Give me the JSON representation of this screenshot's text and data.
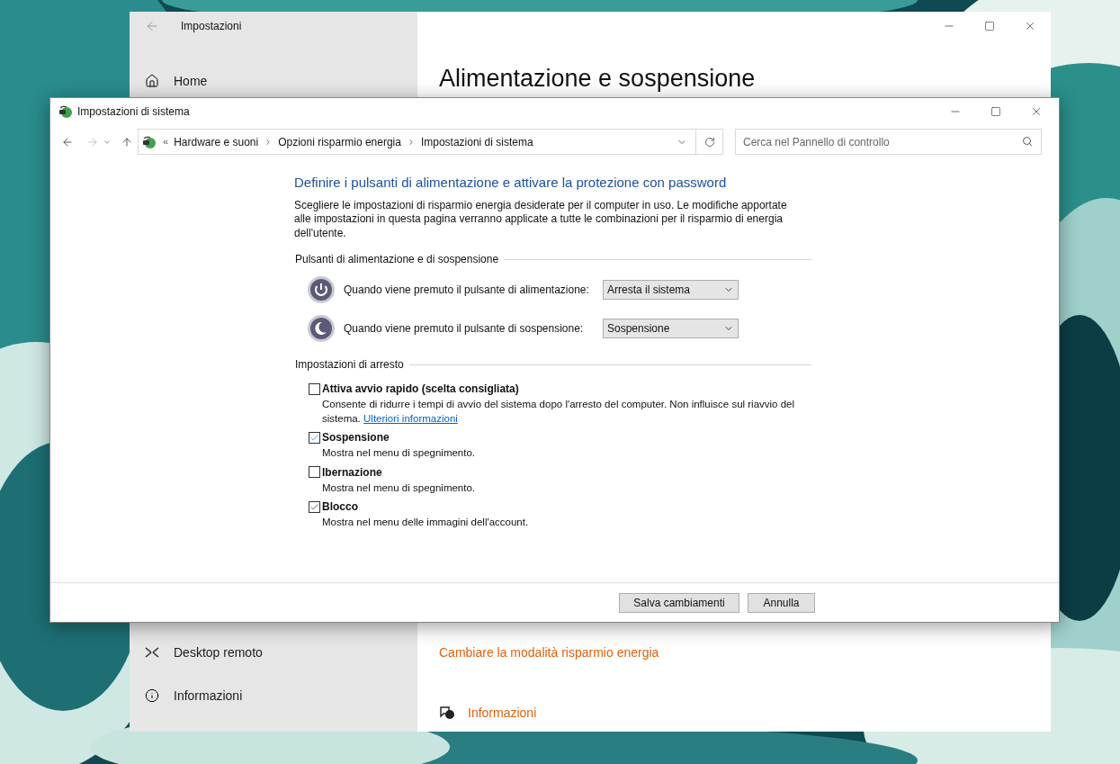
{
  "settings_window": {
    "title": "Impostazioni",
    "sidebar_top": [
      {
        "label": "Home",
        "kind": "home"
      }
    ],
    "sidebar_bottom": [
      {
        "label": "Desktop remoto",
        "kind": "remote"
      },
      {
        "label": "Informazioni",
        "kind": "info"
      }
    ],
    "heading": "Alimentazione e sospensione",
    "link": "Cambiare la modalità risparmio energia",
    "help_link": "Informazioni"
  },
  "control_panel": {
    "title": "Impostazioni di sistema",
    "breadcrumb_prefix": "«",
    "breadcrumb": [
      "Hardware e suoni",
      "Opzioni risparmio energia",
      "Impostazioni di sistema"
    ],
    "search": {
      "placeholder": "Cerca nel Pannello di controllo"
    },
    "heading": "Definire i pulsanti di alimentazione e attivare la protezione con password",
    "description": "Scegliere le impostazioni di risparmio energia desiderate per il computer in uso. Le modifiche apportate alle impostazioni in questa pagina verranno applicate a tutte le combinazioni per il risparmio di energia dell'utente.",
    "buttons_section": {
      "title": "Pulsanti di alimentazione e di sospensione",
      "rows": [
        {
          "kind": "power",
          "label": "Quando viene premuto il pulsante di alimentazione:",
          "value": "Arresta il sistema"
        },
        {
          "kind": "sleep",
          "label": "Quando viene premuto il pulsante di sospensione:",
          "value": "Sospensione"
        }
      ]
    },
    "shutdown_section": {
      "title": "Impostazioni di arresto",
      "options": [
        {
          "label": "Attiva avvio rapido (scelta consigliata)",
          "checked": false,
          "description": "Consente di ridurre i tempi di avvio del sistema dopo l'arresto del computer. Non influisce sul riavvio del sistema.",
          "link": "Ulteriori informazioni"
        },
        {
          "label": "Sospensione",
          "checked": true,
          "description": "Mostra nel menu di spegnimento."
        },
        {
          "label": "Ibernazione",
          "checked": false,
          "description": "Mostra nel menu di spegnimento."
        },
        {
          "label": "Blocco",
          "checked": true,
          "description": "Mostra nel menu delle immagini dell'account."
        }
      ]
    },
    "actions": [
      "Salva cambiamenti",
      "Annulla"
    ]
  }
}
